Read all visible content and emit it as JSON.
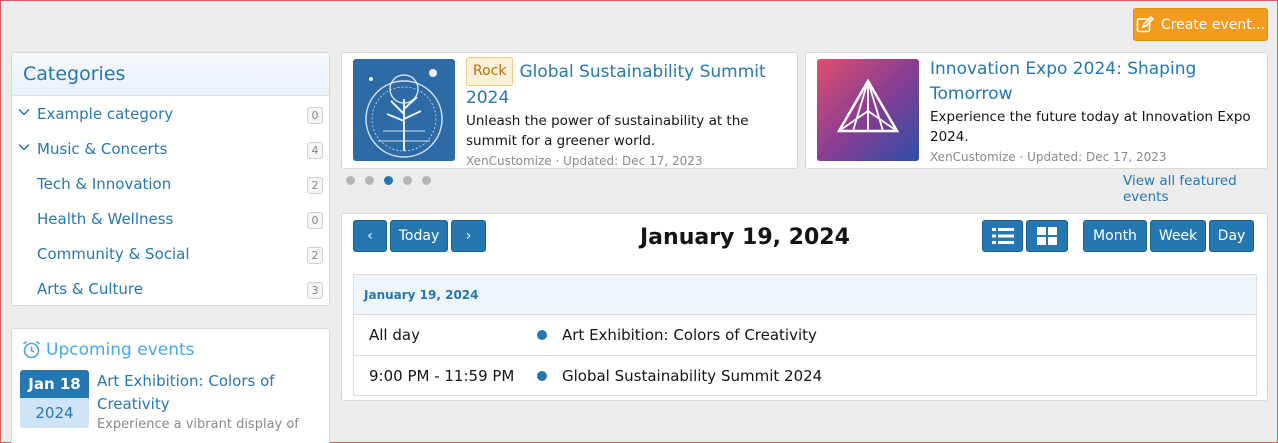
{
  "header": {
    "create_event_label": "Create event..."
  },
  "categories": {
    "title": "Categories",
    "items": [
      {
        "label": "Example category",
        "count": "0",
        "expanded": true
      },
      {
        "label": "Music & Concerts",
        "count": "4",
        "expanded": true
      },
      {
        "label": "Tech & Innovation",
        "count": "2"
      },
      {
        "label": "Health & Wellness",
        "count": "0"
      },
      {
        "label": "Community & Social",
        "count": "2"
      },
      {
        "label": "Arts & Culture",
        "count": "3"
      }
    ]
  },
  "upcoming": {
    "title": "Upcoming events",
    "items": [
      {
        "month_day": "Jan 18",
        "year": "2024",
        "title": "Art Exhibition: Colors of Creativity",
        "desc": "Experience a vibrant display of"
      }
    ]
  },
  "featured": {
    "cards": [
      {
        "tag": "Rock",
        "title": "Global Sustainability Summit 2024",
        "desc": "Unleash the power of sustainability at the summit for a greener world.",
        "meta": "XenCustomize · Updated: Dec 17, 2023"
      },
      {
        "title": "Innovation Expo 2024: Shaping Tomorrow",
        "desc": "Experience the future today at Innovation Expo 2024.",
        "meta": "XenCustomize · Updated: Dec 17, 2023"
      }
    ],
    "active_dot_index": 2,
    "dot_count": 5,
    "view_all_label": "View all featured events"
  },
  "calendar": {
    "prev_label": "‹",
    "today_label": "Today",
    "next_label": "›",
    "title": "January 19, 2024",
    "views": [
      "Month",
      "Week",
      "Day"
    ],
    "agenda_date": "January 19, 2024",
    "events": [
      {
        "time": "All day",
        "title": "Art Exhibition: Colors of Creativity"
      },
      {
        "time": "9:00 PM - 11:59 PM",
        "title": "Global Sustainability Summit 2024"
      }
    ]
  },
  "colors": {
    "accent": "#2577b1",
    "create": "#f29b1d"
  }
}
